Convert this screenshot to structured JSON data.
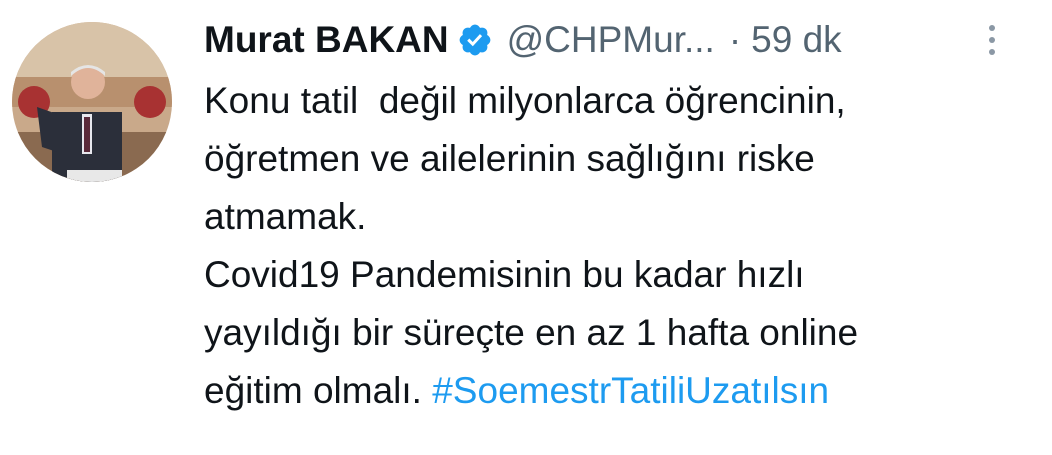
{
  "tweet": {
    "author_name": "Murat BAKAN",
    "handle": "@CHPMur...",
    "separator": "·",
    "time": "59 dk",
    "text_lines": [
      "Konu tatil  değil milyonlarca öğrencinin,",
      "öğretmen ve ailelerinin sağlığını riske",
      "atmamak.",
      "Covid19 Pandemisinin bu kadar hızlı",
      "yayıldığı bir süreçte en az 1 hafta online",
      "eğitim olmalı. "
    ],
    "hashtag": "#SoemestrTatiliUzatılsın"
  },
  "icons": {
    "verified": "verified-badge-icon",
    "more": "more-vertical-icon"
  },
  "colors": {
    "text": "#0f1419",
    "secondary": "#536471",
    "link": "#1d9bf0",
    "verified": "#1d9bf0"
  }
}
